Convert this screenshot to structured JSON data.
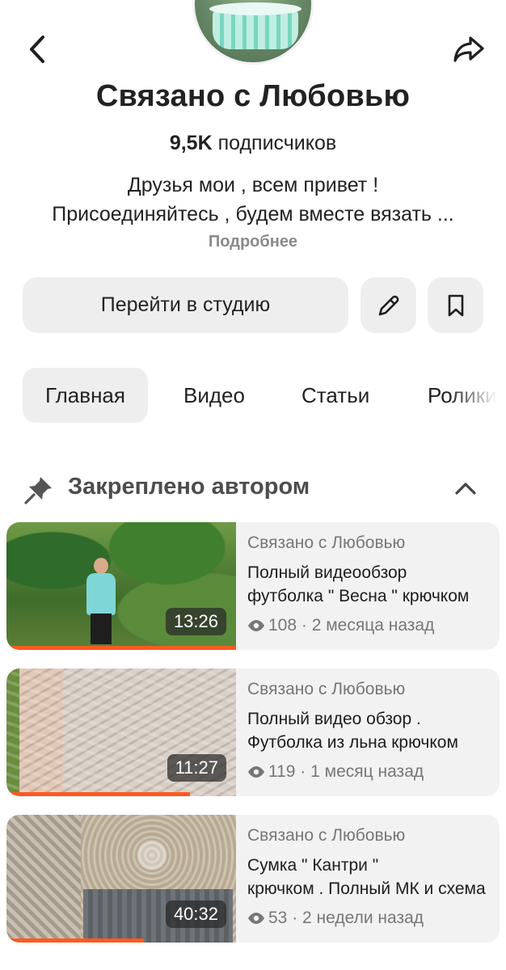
{
  "header": {
    "back_icon": "chevron-left-icon",
    "share_icon": "share-arrow-icon"
  },
  "channel": {
    "name": "Связано с Любовью",
    "subscribers_count": "9,5K",
    "subscribers_label": "подписчиков",
    "description_line1": "Друзья мои  , всем привет !",
    "description_line2": "Присоединяйтесь , будем вместе вязать ...",
    "more_label": "Подробнее"
  },
  "actions": {
    "studio_label": "Перейти в студию",
    "edit_icon": "pencil-icon",
    "bookmark_icon": "bookmark-icon"
  },
  "tabs": [
    {
      "label": "Главная",
      "active": true
    },
    {
      "label": "Видео",
      "active": false
    },
    {
      "label": "Статьи",
      "active": false
    },
    {
      "label": "Ролики",
      "active": false
    }
  ],
  "pinned": {
    "label": "Закреплено автором",
    "pin_icon": "pin-icon",
    "collapse_icon": "chevron-up-icon"
  },
  "videos": [
    {
      "channel": "Связано с Любовью",
      "title_line1": "Полный видеообзор",
      "title_line2": "футболка \" Весна \" крючком",
      "views": "108",
      "age": "2 месяца назад",
      "duration": "13:26",
      "progress": 1.0
    },
    {
      "channel": "Связано с Любовью",
      "title_line1": "Полный видео обзор .",
      "title_line2": "Футболка из льна крючком",
      "views": "119",
      "age": "1 месяц назад",
      "duration": "11:27",
      "progress": 0.8
    },
    {
      "channel": "Связано с Любовью",
      "title_line1": "Сумка \" Кантри \"",
      "title_line2": "крючком . Полный МК и схема",
      "views": "53",
      "age": "2 недели назад",
      "duration": "40:32",
      "progress": 0.6
    }
  ],
  "colors": {
    "accent_progress": "#ff5a1f",
    "button_bg": "#eeeeee",
    "card_bg": "#f2f2f2"
  }
}
